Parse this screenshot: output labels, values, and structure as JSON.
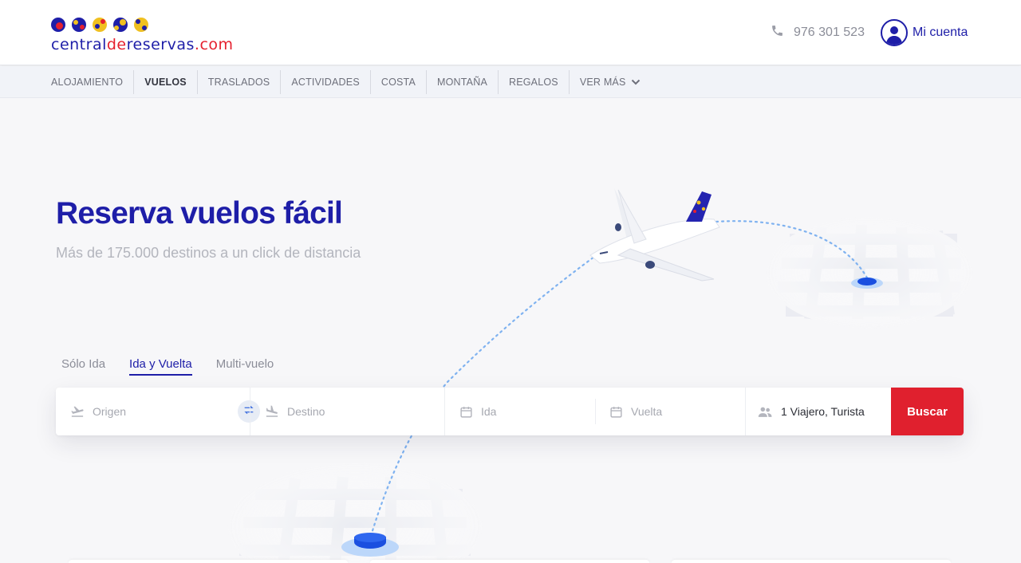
{
  "brand": {
    "logo_prefix": "central",
    "logo_de": "de",
    "logo_suffix": "reservas",
    "logo_tld": ".com",
    "colors": {
      "primary": "#1e1ea8",
      "accent": "#e0202e"
    }
  },
  "header": {
    "phone_icon": "phone-icon",
    "phone": "976 301 523",
    "account_icon": "user-circle-icon",
    "account_label": "Mi cuenta"
  },
  "nav": {
    "items": [
      {
        "label": "ALOJAMIENTO"
      },
      {
        "label": "VUELOS",
        "active": true
      },
      {
        "label": "TRASLADOS"
      },
      {
        "label": "ACTIVIDADES"
      },
      {
        "label": "COSTA"
      },
      {
        "label": "MONTAÑA"
      },
      {
        "label": "REGALOS"
      },
      {
        "label": "VER MÁS",
        "icon": "chevron-down-icon"
      }
    ]
  },
  "hero": {
    "title": "Reserva vuelos fácil",
    "subtitle": "Más de 175.000 destinos a un click de distancia"
  },
  "tabs": [
    {
      "label": "Sólo Ida"
    },
    {
      "label": "Ida y Vuelta",
      "active": true
    },
    {
      "label": "Multi-vuelo"
    }
  ],
  "search": {
    "origin_placeholder": "Origen",
    "destination_placeholder": "Destino",
    "departure_placeholder": "Ida",
    "return_placeholder": "Vuelta",
    "travelers": "1 Viajero, Turista",
    "button": "Buscar"
  }
}
